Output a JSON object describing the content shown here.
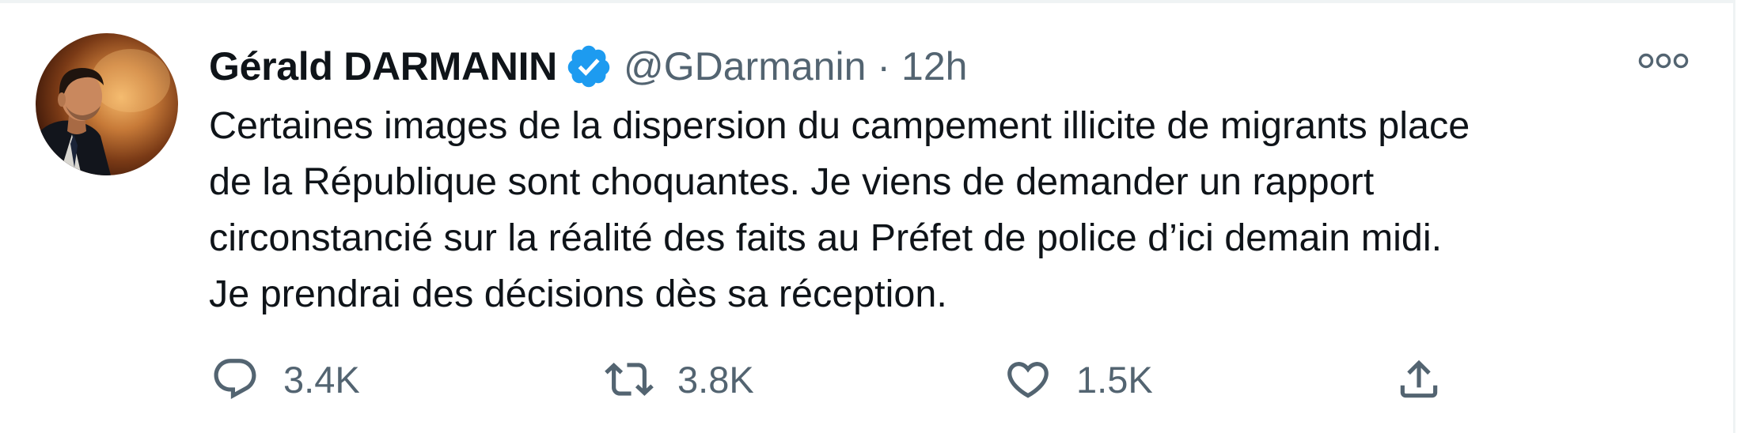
{
  "author": {
    "name": "Gérald DARMANIN",
    "handle": "@GDarmanin",
    "separator": "·",
    "time": "12h",
    "verified": true
  },
  "tweet": {
    "lines": [
      "Certaines images de la dispersion du campement illicite de migrants place",
      "de la République sont choquantes. Je viens de demander un rapport",
      "circonstancié sur la réalité des faits au Préfet de police d’ici demain midi.",
      "Je prendrai des décisions dès sa réception."
    ]
  },
  "actions": {
    "reply": {
      "icon": "reply-icon",
      "count": "3.4K"
    },
    "retweet": {
      "icon": "retweet-icon",
      "count": "3.8K"
    },
    "like": {
      "icon": "heart-icon",
      "count": "1.5K"
    },
    "share": {
      "icon": "share-icon"
    }
  },
  "colors": {
    "text": "#0f1419",
    "secondary": "#536471",
    "verified": "#1d9bf0",
    "border": "#eff3f4"
  }
}
